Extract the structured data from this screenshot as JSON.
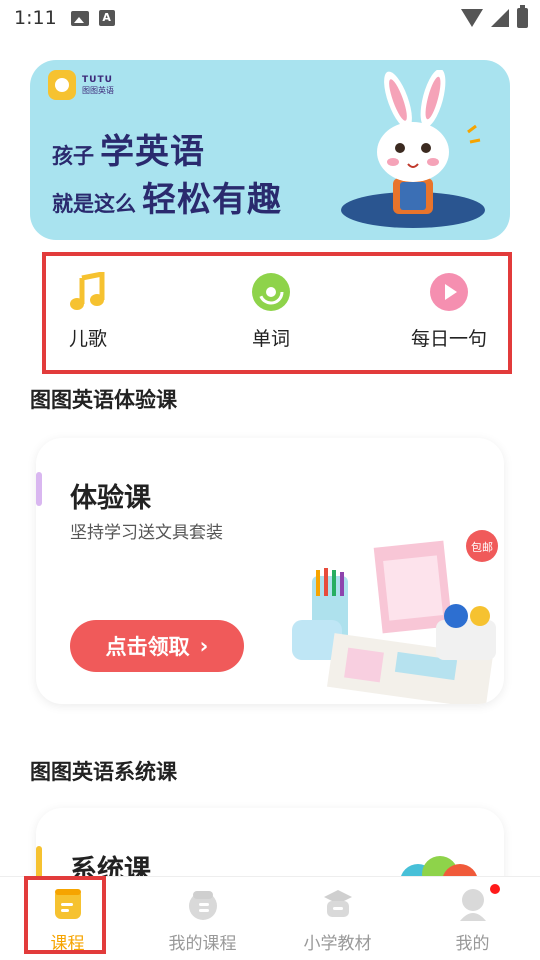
{
  "status_bar": {
    "time": "1:11",
    "left_icons": [
      "image-icon",
      "font-a-icon"
    ],
    "right_icons": [
      "wifi-icon",
      "signal-icon",
      "battery-charging-icon"
    ]
  },
  "banner": {
    "logo_en": "TUTU",
    "logo_cn": "图图英语",
    "line1_small": "孩子",
    "line1_big": "学英语",
    "line2_small": "就是这么",
    "line2_big": "轻松有趣",
    "background_color": "#a9e3ef"
  },
  "quick_menu": {
    "items": [
      {
        "label": "儿歌",
        "icon": "music-note-icon",
        "color": "#f6c230"
      },
      {
        "label": "单词",
        "icon": "disc-icon",
        "color": "#8ed34a"
      },
      {
        "label": "每日一句",
        "icon": "play-icon",
        "color": "#f58fb0"
      }
    ]
  },
  "sections": {
    "trial_title": "图图英语体验课",
    "system_title": "图图英语系统课"
  },
  "trial_card": {
    "title": "体验课",
    "subtitle": "坚持学习送文具套装",
    "cta_label": "点击领取",
    "cta_arrow": "›",
    "badge": "包邮"
  },
  "system_card": {
    "title": "系统课"
  },
  "bottom_nav": {
    "items": [
      {
        "label": "课程",
        "icon": "course-book-icon",
        "active": true
      },
      {
        "label": "我的课程",
        "icon": "my-course-icon",
        "active": false
      },
      {
        "label": "小学教材",
        "icon": "textbook-icon",
        "active": false
      },
      {
        "label": "我的",
        "icon": "profile-icon",
        "active": false
      }
    ]
  },
  "colors": {
    "accent_yellow": "#f6a400",
    "cta_red": "#f05a5a",
    "highlight_red": "#e23b3b"
  }
}
